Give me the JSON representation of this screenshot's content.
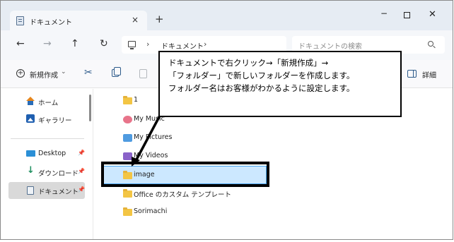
{
  "window": {
    "tab_title": "ドキュメント",
    "tab_close": "×",
    "new_tab": "+",
    "minimize": "−",
    "close": "✕"
  },
  "nav": {
    "back": "←",
    "forward": "→",
    "up": "↑",
    "refresh": "↻",
    "address_sep": "›",
    "breadcrumb": "ドキュメント",
    "search_placeholder": "ドキュメントの検索"
  },
  "toolbar": {
    "new_label": "新規作成",
    "new_chevron": "⌄",
    "cut": "✂",
    "details_label": "詳細"
  },
  "sidebar": {
    "pin": "📌",
    "items": [
      {
        "label": "ホーム",
        "icon": "home-icon"
      },
      {
        "label": "ギャラリー",
        "icon": "gallery-icon"
      },
      {
        "label": "Desktop",
        "icon": "desktop-icon",
        "pinned": true
      },
      {
        "label": "ダウンロード",
        "icon": "download-icon",
        "pinned": true,
        "glyph": "↓"
      },
      {
        "label": "ドキュメント",
        "icon": "documents-icon",
        "pinned": true,
        "selected": true
      }
    ]
  },
  "files": [
    {
      "name": "1",
      "icon": "folder-icon"
    },
    {
      "name": "My Music",
      "icon": "music-folder-icon"
    },
    {
      "name": "My Pictures",
      "icon": "pictures-folder-icon"
    },
    {
      "name": "My Videos",
      "icon": "videos-folder-icon"
    },
    {
      "name": "image",
      "icon": "folder-icon",
      "selected": true
    },
    {
      "name": "Office のカスタム テンプレート",
      "icon": "folder-icon"
    },
    {
      "name": "Sorimachi",
      "icon": "folder-icon"
    }
  ],
  "callout": {
    "lines": [
      "ドキュメントで右クリック→「新規作成」→",
      "「フォルダー」で新しいフォルダーを作成します。",
      "フォルダー名はお客様がわかるように設定します。"
    ]
  },
  "colors": {
    "selection_fill": "#cce8ff",
    "selection_border": "#4aa3ee",
    "folder": "#f3c544",
    "highlight_frame": "#000000"
  }
}
